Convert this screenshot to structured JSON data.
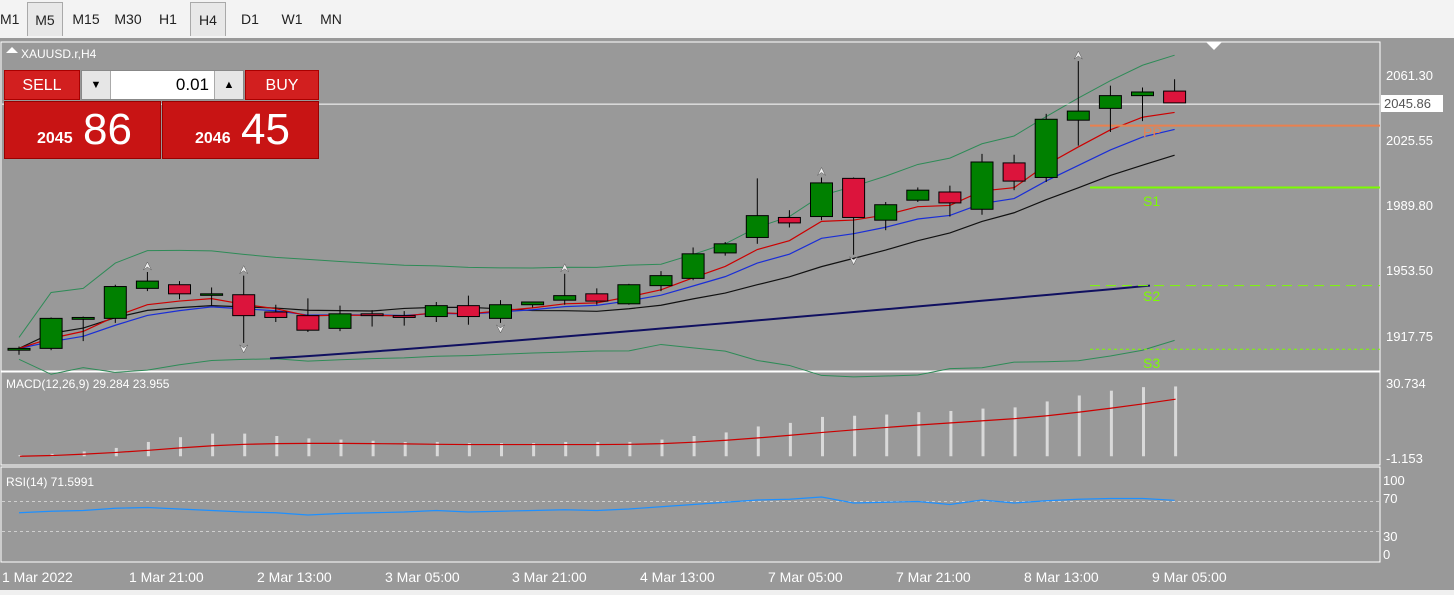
{
  "toolbar": {
    "timeframes": [
      {
        "label": "M1",
        "active": false
      },
      {
        "label": "M5",
        "active": true
      },
      {
        "label": "M15",
        "active": false
      },
      {
        "label": "M30",
        "active": false
      },
      {
        "label": "H1",
        "active": false
      },
      {
        "label": "H4",
        "active": true
      },
      {
        "label": "D1",
        "active": false
      },
      {
        "label": "W1",
        "active": false
      },
      {
        "label": "MN",
        "active": false
      }
    ]
  },
  "chart": {
    "symbol_label": "XAUUSD.r,H4",
    "price_labels": [
      "2061.30",
      "2025.55",
      "1989.80",
      "1953.50",
      "1917.75"
    ],
    "current_price": "2045.86",
    "pivot_labels": [
      "PP",
      "S1",
      "S2",
      "S3"
    ],
    "macd_label": "MACD(12,26,9) 29.284 23.955",
    "macd_scale": [
      "30.734",
      "-1.153"
    ],
    "rsi_label": "RSI(14) 71.5991",
    "rsi_scale": [
      "100",
      "70",
      "30",
      "0"
    ],
    "date_labels": [
      "1 Mar 2022",
      "1 Mar 21:00",
      "2 Mar 13:00",
      "3 Mar 05:00",
      "3 Mar 21:00",
      "4 Mar 13:00",
      "7 Mar 05:00",
      "7 Mar 21:00",
      "8 Mar 13:00",
      "9 Mar 05:00"
    ]
  },
  "trade_panel": {
    "sell_label": "SELL",
    "buy_label": "BUY",
    "lot_value": "0.01",
    "sell_price_prefix": "2045",
    "sell_price_big": "86",
    "buy_price_prefix": "2046",
    "buy_price_big": "45"
  },
  "colors": {
    "background": "#999999",
    "bull_candle": "#008000",
    "bear_candle": "#dc143c",
    "pivot_pp": "#e9804f",
    "pivot_support": "#7cfc00",
    "ma_red": "#cc0000",
    "ma_blue": "#1a2ed6",
    "ma_black": "#111111",
    "ma_navy": "#101060",
    "rsi_line": "#1e90ff"
  },
  "chart_data": {
    "type": "candlestick",
    "symbol": "XAUUSD.r",
    "timeframe": "H4",
    "candles": [
      {
        "o": 1910.5,
        "h": 1912.5,
        "l": 1908.0,
        "c": 1911.5
      },
      {
        "o": 1911.5,
        "h": 1928.5,
        "l": 1910.5,
        "c": 1928.0
      },
      {
        "o": 1927.5,
        "h": 1929.0,
        "l": 1915.5,
        "c": 1928.5
      },
      {
        "o": 1928.0,
        "h": 1946.5,
        "l": 1925.5,
        "c": 1945.5
      },
      {
        "o": 1944.5,
        "h": 1953.5,
        "l": 1943.0,
        "c": 1948.5
      },
      {
        "o": 1946.5,
        "h": 1948.5,
        "l": 1938.5,
        "c": 1941.5
      },
      {
        "o": 1941.5,
        "h": 1945.0,
        "l": 1935.0,
        "c": 1941.5
      },
      {
        "o": 1941.0,
        "h": 1951.5,
        "l": 1914.5,
        "c": 1929.5
      },
      {
        "o": 1931.5,
        "h": 1935.5,
        "l": 1926.0,
        "c": 1928.5
      },
      {
        "o": 1929.5,
        "h": 1939.0,
        "l": 1920.5,
        "c": 1921.5
      },
      {
        "o": 1922.5,
        "h": 1935.0,
        "l": 1921.0,
        "c": 1930.5
      },
      {
        "o": 1930.5,
        "h": 1932.5,
        "l": 1923.5,
        "c": 1929.5
      },
      {
        "o": 1929.5,
        "h": 1932.0,
        "l": 1924.0,
        "c": 1928.5
      },
      {
        "o": 1929.0,
        "h": 1937.0,
        "l": 1926.0,
        "c": 1935.0
      },
      {
        "o": 1935.0,
        "h": 1940.5,
        "l": 1924.5,
        "c": 1929.0
      },
      {
        "o": 1928.0,
        "h": 1938.0,
        "l": 1925.5,
        "c": 1935.5
      },
      {
        "o": 1935.5,
        "h": 1937.0,
        "l": 1934.0,
        "c": 1937.0
      },
      {
        "o": 1938.0,
        "h": 1952.5,
        "l": 1935.5,
        "c": 1940.5
      },
      {
        "o": 1941.5,
        "h": 1944.5,
        "l": 1935.5,
        "c": 1937.5
      },
      {
        "o": 1936.0,
        "h": 1947.0,
        "l": 1935.5,
        "c": 1946.5
      },
      {
        "o": 1946.0,
        "h": 1954.0,
        "l": 1943.0,
        "c": 1951.5
      },
      {
        "o": 1950.0,
        "h": 1967.0,
        "l": 1949.0,
        "c": 1963.5
      },
      {
        "o": 1964.0,
        "h": 1970.0,
        "l": 1962.5,
        "c": 1969.0
      },
      {
        "o": 1972.5,
        "h": 2005.0,
        "l": 1969.0,
        "c": 1984.5
      },
      {
        "o": 1983.5,
        "h": 1987.5,
        "l": 1978.0,
        "c": 1980.5
      },
      {
        "o": 1984.0,
        "h": 2005.5,
        "l": 1982.0,
        "c": 2002.5
      },
      {
        "o": 2005.0,
        "h": 2005.5,
        "l": 1963.0,
        "c": 1983.5
      },
      {
        "o": 1982.0,
        "h": 1992.0,
        "l": 1976.5,
        "c": 1990.5
      },
      {
        "o": 1993.0,
        "h": 2000.0,
        "l": 1992.0,
        "c": 1998.5
      },
      {
        "o": 1997.5,
        "h": 2001.0,
        "l": 1984.0,
        "c": 1991.5
      },
      {
        "o": 1988.0,
        "h": 2018.5,
        "l": 1985.0,
        "c": 2014.0
      },
      {
        "o": 2013.5,
        "h": 2018.0,
        "l": 1998.5,
        "c": 2003.5
      },
      {
        "o": 2005.5,
        "h": 2040.5,
        "l": 2003.0,
        "c": 2037.5
      },
      {
        "o": 2037.0,
        "h": 2069.5,
        "l": 2023.0,
        "c": 2042.0
      },
      {
        "o": 2043.5,
        "h": 2056.0,
        "l": 2030.5,
        "c": 2050.5
      },
      {
        "o": 2050.5,
        "h": 2055.0,
        "l": 2036.5,
        "c": 2052.5
      },
      {
        "o": 2053.0,
        "h": 2059.5,
        "l": 2047.5,
        "c": 2046.5
      }
    ],
    "current_price": 2045.86,
    "y_ticks": [
      2061.3,
      2025.55,
      1989.8,
      1953.5,
      1917.75
    ],
    "pivots": {
      "PP": 2034.0,
      "S1": 2000.0,
      "S2": 1946.0,
      "S3": 1911.0
    },
    "macd": {
      "max": 30.734,
      "min": -1.153,
      "histogram": [
        0.5,
        1.0,
        2.0,
        3.5,
        6.0,
        8.0,
        9.5,
        9.5,
        8.5,
        7.5,
        7.0,
        6.5,
        6.0,
        6.0,
        5.5,
        5.5,
        5.5,
        6.0,
        6.0,
        6.0,
        7.0,
        8.5,
        10.0,
        12.5,
        14.0,
        16.5,
        17.0,
        17.5,
        18.5,
        19.0,
        20.0,
        20.5,
        23.0,
        25.5,
        27.5,
        29.0,
        29.284
      ],
      "signal": [
        0.0,
        0.3,
        0.9,
        1.6,
        2.5,
        3.5,
        4.4,
        5.0,
        5.3,
        5.4,
        5.4,
        5.3,
        5.2,
        5.0,
        4.9,
        4.9,
        4.9,
        4.9,
        4.9,
        5.0,
        5.3,
        5.9,
        6.7,
        7.7,
        8.8,
        10.0,
        11.1,
        12.1,
        13.1,
        14.0,
        14.9,
        15.8,
        17.0,
        18.5,
        20.2,
        22.0,
        23.955
      ]
    },
    "rsi": [
      55,
      57,
      58,
      61,
      62,
      60,
      58,
      56,
      55,
      52,
      54,
      55,
      56,
      58,
      56,
      57,
      58,
      59,
      58,
      60,
      63,
      66,
      69,
      72,
      73,
      76,
      68,
      69,
      70,
      66,
      72,
      68,
      71,
      73,
      74,
      74,
      71.5991
    ]
  }
}
